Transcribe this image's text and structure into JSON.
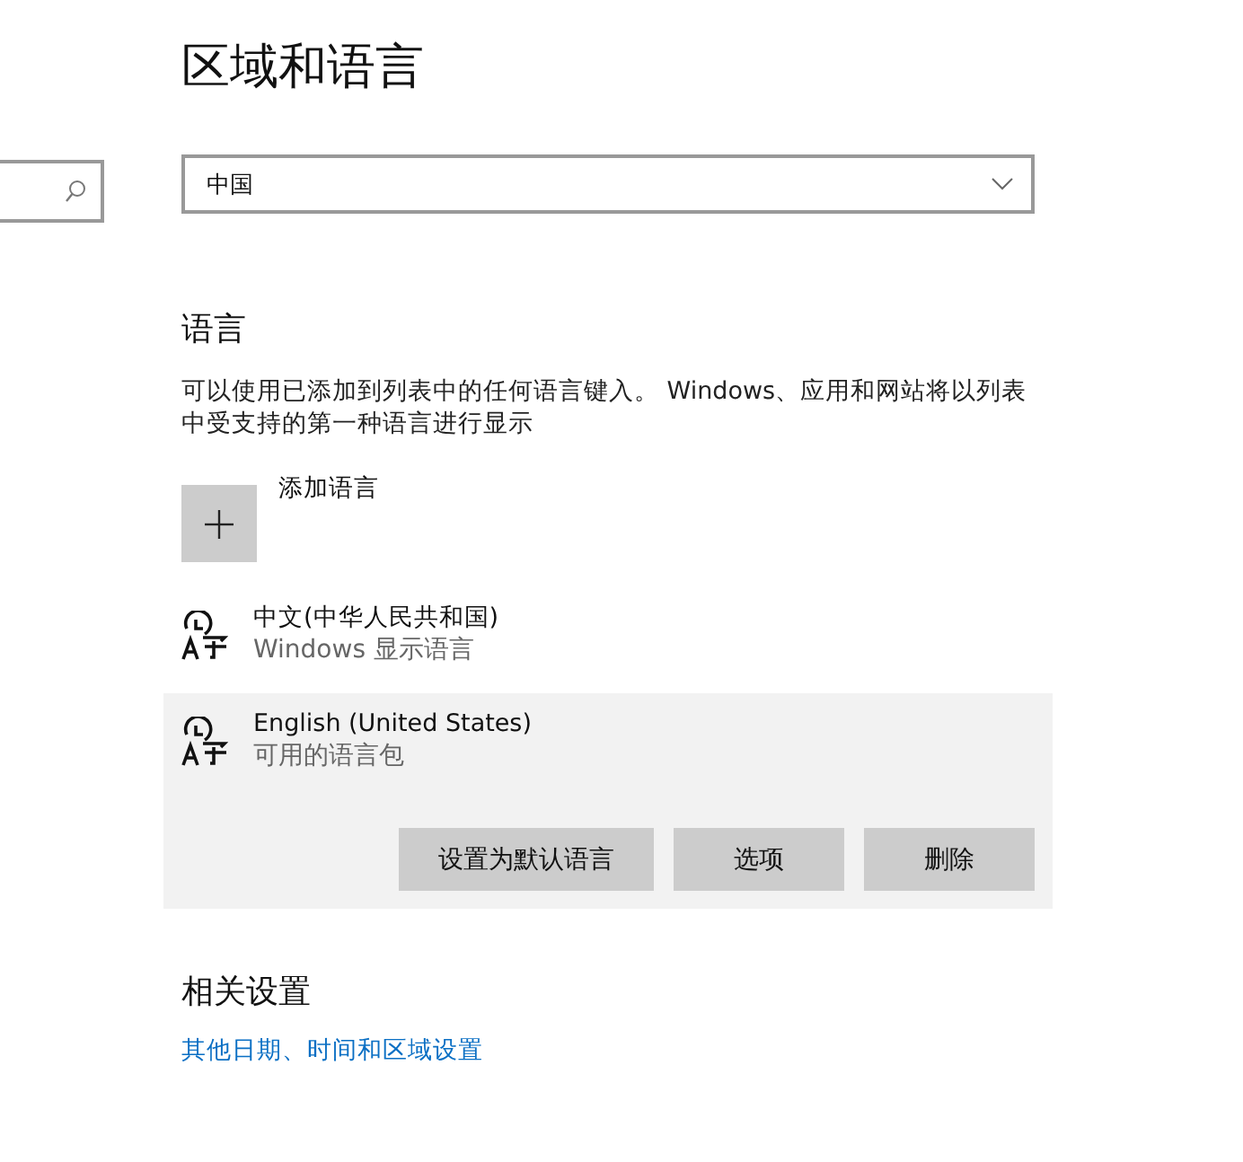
{
  "page": {
    "title": "区域和语言"
  },
  "region": {
    "value": "中国"
  },
  "language_section": {
    "heading": "语言",
    "description": "可以使用已添加到列表中的任何语言键入。 Windows、应用和网站将以列表中受支持的第一种语言进行显示",
    "add_label": "添加语言"
  },
  "languages": [
    {
      "name": "中文(中华人民共和国)",
      "status": "Windows 显示语言",
      "selected": false
    },
    {
      "name": "English (United States)",
      "status": "可用的语言包",
      "selected": true,
      "actions": [
        "设置为默认语言",
        "选项",
        "删除"
      ]
    }
  ],
  "related": {
    "heading": "相关设置",
    "link": "其他日期、时间和区域设置"
  }
}
